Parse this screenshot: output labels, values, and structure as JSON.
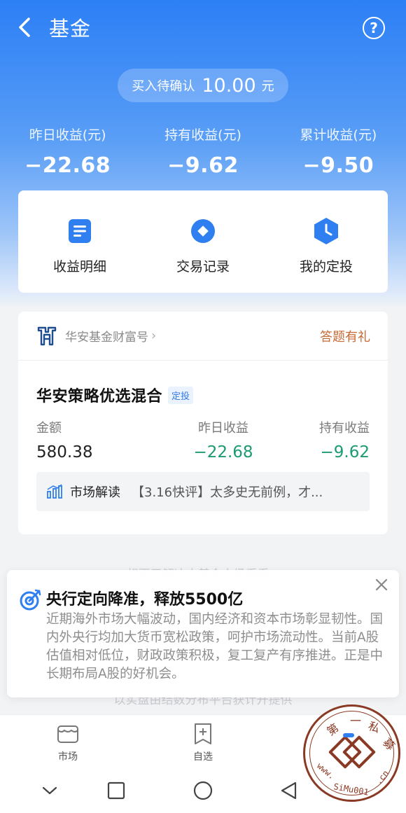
{
  "header": {
    "title": "基金",
    "help_label": "?"
  },
  "pending": {
    "label": "买入待确认",
    "amount": "10.00",
    "unit": "元"
  },
  "stats": [
    {
      "label": "昨日收益(元)",
      "value": "−22.68"
    },
    {
      "label": "持有收益(元)",
      "value": "−9.62"
    },
    {
      "label": "累计收益(元)",
      "value": "−9.50"
    }
  ],
  "actions": [
    {
      "label": "收益明细",
      "icon": "document-icon"
    },
    {
      "label": "交易记录",
      "icon": "record-icon"
    },
    {
      "label": "我的定投",
      "icon": "clock-icon"
    }
  ],
  "fund_card": {
    "brand": "华安基金财富号",
    "promo": "答题有礼",
    "fund_name": "华安策略优选混合",
    "tag": "定投",
    "columns": [
      {
        "label": "金额",
        "value": "580.38"
      },
      {
        "label": "昨日收益",
        "value": "−22.68"
      },
      {
        "label": "持有收益",
        "value": "−9.62"
      }
    ],
    "market": {
      "label": "市场解读",
      "text": "【3.16快评】太多史无前例，才..."
    }
  },
  "ghost_text": {
    "line1": "想更了解这支基金市场看看>",
    "line2": "以实盘由结数分布平台获计开提供"
  },
  "popup": {
    "title": "央行定向降准，释放5500亿",
    "body": "近期海外市场大幅波动，国内经济和资本市场彰显韧性。国内外央行均加大货币宽松政策，呵护市场流动性。当前A股估值相对低位，财政政策积极，复工复产有序推进。正是中长期布局A股的好机会。"
  },
  "tabbar": [
    {
      "label": "市场",
      "icon": "market-icon"
    },
    {
      "label": "自选",
      "icon": "add-watchlist-icon"
    }
  ],
  "watermark": {
    "text": "第一私募",
    "url": "www.SiMu001.cn"
  },
  "colors": {
    "brand_blue": "#2d7ff5",
    "loss_green": "#1b9a74",
    "promo_orange": "#c86a34"
  }
}
